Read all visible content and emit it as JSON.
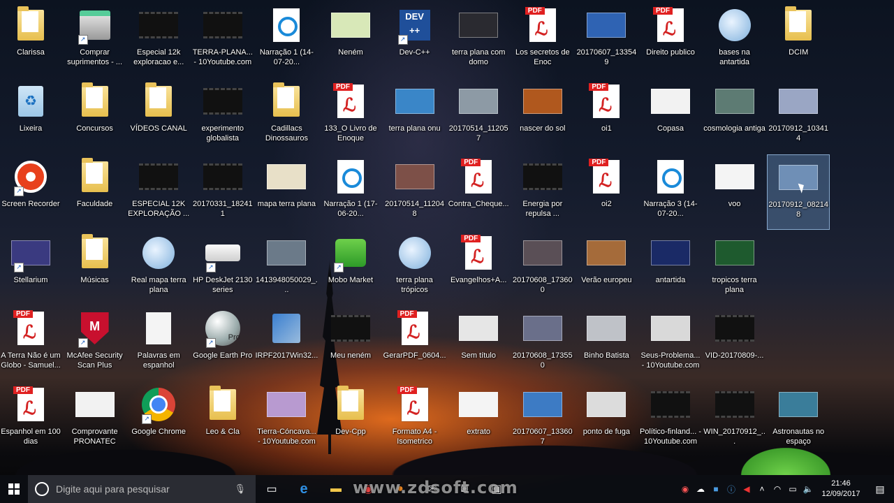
{
  "desktop": {
    "icons": [
      {
        "label": "Clarissa",
        "kind": "folder",
        "col": 0,
        "row": 0
      },
      {
        "label": "Comprar suprimentos - ...",
        "kind": "printer",
        "col": 1,
        "row": 0,
        "shortcut": true
      },
      {
        "label": "Especial 12k exploracao e...",
        "kind": "video",
        "col": 2,
        "row": 0
      },
      {
        "label": "TERRA-PLANA... - 10Youtube.com",
        "kind": "video",
        "col": 3,
        "row": 0
      },
      {
        "label": "Narração 1 (14-07-20...",
        "kind": "circle-doc",
        "col": 4,
        "row": 0
      },
      {
        "label": "Neném",
        "kind": "image",
        "col": 5,
        "row": 0,
        "color": "#d8e8b8"
      },
      {
        "label": "Dev-C++",
        "kind": "app-dev",
        "col": 6,
        "row": 0,
        "shortcut": true
      },
      {
        "label": "terra plana com domo",
        "kind": "image",
        "col": 7,
        "row": 0,
        "color": "#2a2a30"
      },
      {
        "label": "Los secretos de Enoc",
        "kind": "pdf",
        "col": 8,
        "row": 0
      },
      {
        "label": "20170607_133549",
        "kind": "image",
        "col": 9,
        "row": 0,
        "color": "#2f63b3"
      },
      {
        "label": "Direito publico",
        "kind": "pdf",
        "col": 10,
        "row": 0
      },
      {
        "label": "bases na antartida",
        "kind": "globe",
        "col": 11,
        "row": 0
      },
      {
        "label": "DCIM",
        "kind": "folder",
        "col": 12,
        "row": 0
      },
      {
        "label": "Lixeira",
        "kind": "recycle",
        "col": 0,
        "row": 1
      },
      {
        "label": "Concursos",
        "kind": "folder",
        "col": 1,
        "row": 1
      },
      {
        "label": "VÍDEOS CANAL",
        "kind": "folder",
        "col": 2,
        "row": 1
      },
      {
        "label": "experimento globalista",
        "kind": "video",
        "col": 3,
        "row": 1
      },
      {
        "label": "Cadillacs Dinossauros",
        "kind": "folder",
        "col": 4,
        "row": 1
      },
      {
        "label": "133_O Livro de Enoque",
        "kind": "pdf",
        "col": 5,
        "row": 1
      },
      {
        "label": "terra plana onu",
        "kind": "image",
        "col": 6,
        "row": 1,
        "color": "#3a86c8"
      },
      {
        "label": "20170514_112057",
        "kind": "image",
        "col": 7,
        "row": 1,
        "color": "#8d9aa5"
      },
      {
        "label": "nascer do sol",
        "kind": "image",
        "col": 8,
        "row": 1,
        "color": "#b0581e"
      },
      {
        "label": "oi1",
        "kind": "pdf",
        "col": 9,
        "row": 1
      },
      {
        "label": "Copasa",
        "kind": "image",
        "col": 10,
        "row": 1,
        "color": "#f2f2f2"
      },
      {
        "label": "cosmologia antiga",
        "kind": "image",
        "col": 11,
        "row": 1,
        "color": "#5d7b73"
      },
      {
        "label": "20170912_103414",
        "kind": "image",
        "col": 12,
        "row": 1,
        "color": "#9aa6c4"
      },
      {
        "label": "Screen Recorder",
        "kind": "recorder",
        "col": 0,
        "row": 2,
        "shortcut": true
      },
      {
        "label": "Faculdade",
        "kind": "folder",
        "col": 1,
        "row": 2
      },
      {
        "label": "ESPECIAL 12K EXPLORAÇÃO ...",
        "kind": "video",
        "col": 2,
        "row": 2
      },
      {
        "label": "20170331_182411",
        "kind": "video",
        "col": 3,
        "row": 2
      },
      {
        "label": "mapa terra plana",
        "kind": "image",
        "col": 4,
        "row": 2,
        "color": "#e8e0c8"
      },
      {
        "label": "Narração 1 (17-06-20...",
        "kind": "circle-doc",
        "col": 5,
        "row": 2
      },
      {
        "label": "20170514_112048",
        "kind": "image",
        "col": 6,
        "row": 2,
        "color": "#7d5048"
      },
      {
        "label": "Contra_Cheque...",
        "kind": "pdf",
        "col": 7,
        "row": 2
      },
      {
        "label": "Energia por repulsa ...",
        "kind": "video",
        "col": 8,
        "row": 2
      },
      {
        "label": "oi2",
        "kind": "pdf",
        "col": 9,
        "row": 2
      },
      {
        "label": "Narração 3 (14-07-20...",
        "kind": "circle-doc",
        "col": 10,
        "row": 2
      },
      {
        "label": "voo",
        "kind": "image",
        "col": 11,
        "row": 2,
        "color": "#f4f4f4"
      },
      {
        "label": "20170912_082148",
        "kind": "image",
        "col": 12,
        "row": 2,
        "color": "#6f8fb6",
        "selected": true
      },
      {
        "label": "Stellarium",
        "kind": "image",
        "col": 0,
        "row": 3,
        "color": "#3a3a80",
        "shortcut": true
      },
      {
        "label": "Músicas",
        "kind": "folder",
        "col": 1,
        "row": 3
      },
      {
        "label": "Real mapa terra plana",
        "kind": "globe",
        "col": 2,
        "row": 3
      },
      {
        "label": "HP DeskJet 2130 series",
        "kind": "printer2",
        "col": 3,
        "row": 3,
        "shortcut": true
      },
      {
        "label": "1413948050029_...",
        "kind": "image",
        "col": 4,
        "row": 3,
        "color": "#6b7a89"
      },
      {
        "label": "Mobo Market",
        "kind": "market",
        "col": 5,
        "row": 3,
        "shortcut": true
      },
      {
        "label": "terra plana trópicos",
        "kind": "globe",
        "col": 6,
        "row": 3
      },
      {
        "label": "Evangelhos+A...",
        "kind": "pdf",
        "col": 7,
        "row": 3
      },
      {
        "label": "20170608_173600",
        "kind": "image",
        "col": 8,
        "row": 3,
        "color": "#5a4f56"
      },
      {
        "label": "Verão europeu",
        "kind": "image",
        "col": 9,
        "row": 3,
        "color": "#a56b3a"
      },
      {
        "label": "antartida",
        "kind": "image",
        "col": 10,
        "row": 3,
        "color": "#1a2a66"
      },
      {
        "label": "tropicos terra plana",
        "kind": "image",
        "col": 11,
        "row": 3,
        "color": "#1e5a2e"
      },
      {
        "label": "A Terra Não é um Globo - Samuel...",
        "kind": "pdf",
        "col": 0,
        "row": 4
      },
      {
        "label": "McAfee Security Scan Plus",
        "kind": "mcafee",
        "col": 1,
        "row": 4,
        "shortcut": true
      },
      {
        "label": "Palavras em espanhol",
        "kind": "doc",
        "col": 2,
        "row": 4
      },
      {
        "label": "Google Earth Pro",
        "kind": "earth",
        "col": 3,
        "row": 4,
        "shortcut": true
      },
      {
        "label": "IRPF2017Win32...",
        "kind": "irpf",
        "col": 4,
        "row": 4
      },
      {
        "label": "Meu neném",
        "kind": "video",
        "col": 5,
        "row": 4
      },
      {
        "label": "GerarPDF_0604...",
        "kind": "pdf",
        "col": 6,
        "row": 4
      },
      {
        "label": "Sem título",
        "kind": "image",
        "col": 7,
        "row": 4,
        "color": "#e6e6e6"
      },
      {
        "label": "20170608_173550",
        "kind": "image",
        "col": 8,
        "row": 4,
        "color": "#6a6f8a"
      },
      {
        "label": "Binho Batista",
        "kind": "image",
        "col": 9,
        "row": 4,
        "color": "#bfc2c8"
      },
      {
        "label": "Seus-Problema... - 10Youtube.com",
        "kind": "image",
        "col": 10,
        "row": 4,
        "color": "#d9d9d9"
      },
      {
        "label": "VID-20170809-...",
        "kind": "video",
        "col": 11,
        "row": 4
      },
      {
        "label": "Espanhol em 100 dias",
        "kind": "pdf",
        "col": 0,
        "row": 5
      },
      {
        "label": "Comprovante PRONATEC",
        "kind": "image",
        "col": 1,
        "row": 5,
        "color": "#f2f2f2"
      },
      {
        "label": "Google Chrome",
        "kind": "chrome",
        "col": 2,
        "row": 5,
        "shortcut": true
      },
      {
        "label": "Leo & Cla",
        "kind": "folder",
        "col": 3,
        "row": 5
      },
      {
        "label": "Tierra-Cóncava... - 10Youtube.com",
        "kind": "image",
        "col": 4,
        "row": 5,
        "color": "#b89ad0"
      },
      {
        "label": "Dev-Cpp",
        "kind": "folder",
        "col": 5,
        "row": 5
      },
      {
        "label": "Formato A4 - Isometrico",
        "kind": "pdf",
        "col": 6,
        "row": 5
      },
      {
        "label": "extrato",
        "kind": "image",
        "col": 7,
        "row": 5,
        "color": "#f4f4f4"
      },
      {
        "label": "20170607_133607",
        "kind": "image",
        "col": 8,
        "row": 5,
        "color": "#3d7bc4"
      },
      {
        "label": "ponto de fuga",
        "kind": "image",
        "col": 9,
        "row": 5,
        "color": "#dcdcdc"
      },
      {
        "label": "Político-finland... - 10Youtube.com",
        "kind": "video",
        "col": 10,
        "row": 5
      },
      {
        "label": "WIN_20170912_...",
        "kind": "video",
        "col": 11,
        "row": 5
      },
      {
        "label": "Astronautas no espaço",
        "kind": "image",
        "col": 12,
        "row": 5,
        "color": "#3a7d9a"
      }
    ]
  },
  "taskbar": {
    "search_placeholder": "Digite aqui para pesquisar",
    "apps": [
      "task-view",
      "edge",
      "file-explorer",
      "chrome",
      "firefox",
      "mail",
      "camera",
      "photos"
    ],
    "clock_time": "21:46",
    "clock_date": "12/09/2017"
  },
  "watermark": "www.zdsoft.com"
}
